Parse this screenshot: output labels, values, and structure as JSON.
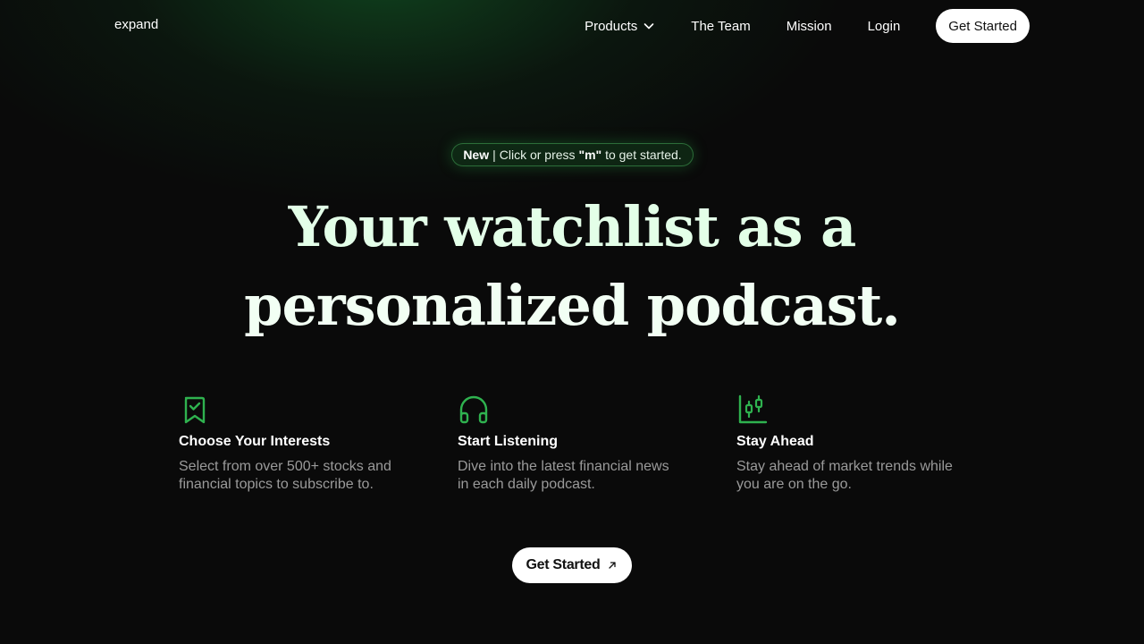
{
  "nav": {
    "logo": "expand",
    "links": [
      "Products",
      "The Team",
      "Mission",
      "Login"
    ],
    "products_icon": "chevron-down-icon",
    "cta_label": "Get Started"
  },
  "badge": {
    "new_label": "New",
    "separator": "|",
    "text_before": "Click or press",
    "key": "\"m\"",
    "text_after": "to get started."
  },
  "hero": {
    "line1": "Your watchlist as a",
    "line2": "personalized podcast."
  },
  "features": [
    {
      "icon": "bookmark-check-icon",
      "title": "Choose Your Interests",
      "description": "Select from over 500+ stocks and financial topics to subscribe to."
    },
    {
      "icon": "headphones-icon",
      "title": "Start Listening",
      "description": "Dive into the latest financial news in each daily podcast."
    },
    {
      "icon": "candlestick-chart-icon",
      "title": "Stay Ahead",
      "description": "Stay ahead of market trends while you are on the go."
    }
  ],
  "cta": {
    "label": "Get Started",
    "icon": "arrow-up-right-icon"
  },
  "colors": {
    "accent_green": "#2fb24f",
    "headline": "#e3ffe8",
    "background": "#0a0a0a",
    "muted_text": "#9a9a9a"
  }
}
